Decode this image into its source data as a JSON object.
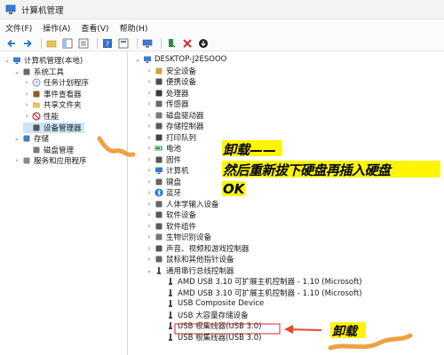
{
  "window": {
    "title": "计算机管理"
  },
  "menu": [
    "文件(F)",
    "操作(A)",
    "查看(V)",
    "帮助(H)"
  ],
  "left_tree": [
    {
      "label": "计算机管理(本地)",
      "level": 0,
      "arrow": "⌄",
      "icon": "computer-manage-icon"
    },
    {
      "label": "系统工具",
      "level": 1,
      "arrow": "⌄",
      "icon": "tools-icon"
    },
    {
      "label": "任务计划程序",
      "level": 2,
      "arrow": "›",
      "icon": "clock-icon"
    },
    {
      "label": "事件查看器",
      "level": 2,
      "arrow": "›",
      "icon": "event-icon"
    },
    {
      "label": "共享文件夹",
      "level": 2,
      "arrow": "›",
      "icon": "folder-icon"
    },
    {
      "label": "性能",
      "level": 2,
      "arrow": "›",
      "icon": "no-icon"
    },
    {
      "label": "设备管理器",
      "level": 2,
      "arrow": "",
      "icon": "device-manager-icon",
      "selected": true
    },
    {
      "label": "存储",
      "level": 1,
      "arrow": "⌄",
      "icon": "storage-icon"
    },
    {
      "label": "磁盘管理",
      "level": 2,
      "arrow": "",
      "icon": "disk-icon"
    },
    {
      "label": "服务和应用程序",
      "level": 1,
      "arrow": "›",
      "icon": "services-icon"
    }
  ],
  "device_tree": [
    {
      "label": "DESKTOP-J2ESOOO",
      "level": 0,
      "arrow": "⌄",
      "icon": "computer-icon"
    },
    {
      "label": "安全设备",
      "level": 1,
      "arrow": "›",
      "icon": "security-icon"
    },
    {
      "label": "便携设备",
      "level": 1,
      "arrow": "›",
      "icon": "portable-icon"
    },
    {
      "label": "处理器",
      "level": 1,
      "arrow": "›",
      "icon": "cpu-icon"
    },
    {
      "label": "传感器",
      "level": 1,
      "arrow": "›",
      "icon": "sensor-icon"
    },
    {
      "label": "磁盘驱动器",
      "level": 1,
      "arrow": "›",
      "icon": "disk-drive-icon"
    },
    {
      "label": "存储控制器",
      "level": 1,
      "arrow": "›",
      "icon": "storage-controller-icon"
    },
    {
      "label": "打印队列",
      "level": 1,
      "arrow": "›",
      "icon": "printer-icon"
    },
    {
      "label": "电池",
      "level": 1,
      "arrow": "›",
      "icon": "battery-icon"
    },
    {
      "label": "固件",
      "level": 1,
      "arrow": "›",
      "icon": "firmware-icon"
    },
    {
      "label": "计算机",
      "level": 1,
      "arrow": "›",
      "icon": "computer-icon"
    },
    {
      "label": "键盘",
      "level": 1,
      "arrow": "›",
      "icon": "keyboard-icon"
    },
    {
      "label": "蓝牙",
      "level": 1,
      "arrow": "›",
      "icon": "bluetooth-icon"
    },
    {
      "label": "人体学输入设备",
      "level": 1,
      "arrow": "›",
      "icon": "hid-icon"
    },
    {
      "label": "软件设备",
      "level": 1,
      "arrow": "›",
      "icon": "software-device-icon"
    },
    {
      "label": "软件组件",
      "level": 1,
      "arrow": "›",
      "icon": "software-component-icon"
    },
    {
      "label": "生物识别设备",
      "level": 1,
      "arrow": "›",
      "icon": "biometric-icon"
    },
    {
      "label": "声音、视频和游戏控制器",
      "level": 1,
      "arrow": "›",
      "icon": "audio-icon"
    },
    {
      "label": "鼠标和其他指针设备",
      "level": 1,
      "arrow": "›",
      "icon": "mouse-icon"
    },
    {
      "label": "通用串行总线控制器",
      "level": 1,
      "arrow": "⌄",
      "icon": "usb-icon"
    },
    {
      "label": "AMD USB 3.10 可扩展主机控制器 - 1.10 (Microsoft)",
      "level": 2,
      "arrow": "",
      "icon": "usb-icon"
    },
    {
      "label": "AMD USB 3.10 可扩展主机控制器 - 1.10 (Microsoft)",
      "level": 2,
      "arrow": "",
      "icon": "usb-icon"
    },
    {
      "label": "USB Composite Device",
      "level": 2,
      "arrow": "",
      "icon": "usb-icon"
    },
    {
      "label": "USB 大容量存储设备",
      "level": 2,
      "arrow": "",
      "icon": "usb-icon",
      "boxed": true
    },
    {
      "label": "USB 根集线器(USB 3.0)",
      "level": 2,
      "arrow": "",
      "icon": "usb-icon"
    },
    {
      "label": "USB 根集线器(USB 3.0)",
      "level": 2,
      "arrow": "",
      "icon": "usb-icon"
    }
  ],
  "annotations": {
    "main_line1": "卸载——",
    "main_line2": "然后重新拔下硬盘再插入硬盘",
    "main_line3": "OK",
    "small": "卸载",
    "highlight_color": "#fff500",
    "arrow_color": "#e24a2a",
    "squiggle_color": "#f0a040"
  },
  "colors": {
    "selection": "#cce4f7",
    "accent": "#1a73c8"
  }
}
